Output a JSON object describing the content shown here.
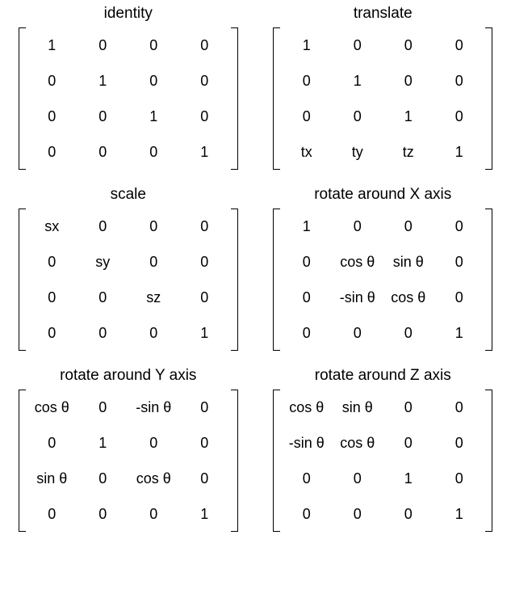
{
  "matrices": [
    {
      "id": "identity",
      "title": "identity",
      "rows": [
        [
          "1",
          "0",
          "0",
          "0"
        ],
        [
          "0",
          "1",
          "0",
          "0"
        ],
        [
          "0",
          "0",
          "1",
          "0"
        ],
        [
          "0",
          "0",
          "0",
          "1"
        ]
      ]
    },
    {
      "id": "translate",
      "title": "translate",
      "rows": [
        [
          "1",
          "0",
          "0",
          "0"
        ],
        [
          "0",
          "1",
          "0",
          "0"
        ],
        [
          "0",
          "0",
          "1",
          "0"
        ],
        [
          "tx",
          "ty",
          "tz",
          "1"
        ]
      ]
    },
    {
      "id": "scale",
      "title": "scale",
      "rows": [
        [
          "sx",
          "0",
          "0",
          "0"
        ],
        [
          "0",
          "sy",
          "0",
          "0"
        ],
        [
          "0",
          "0",
          "sz",
          "0"
        ],
        [
          "0",
          "0",
          "0",
          "1"
        ]
      ]
    },
    {
      "id": "rotate-x",
      "title": "rotate around X axis",
      "rows": [
        [
          "1",
          "0",
          "0",
          "0"
        ],
        [
          "0",
          "cos θ",
          "sin θ",
          "0"
        ],
        [
          "0",
          "-sin θ",
          "cos θ",
          "0"
        ],
        [
          "0",
          "0",
          "0",
          "1"
        ]
      ]
    },
    {
      "id": "rotate-y",
      "title": "rotate around Y axis",
      "rows": [
        [
          "cos θ",
          "0",
          "-sin θ",
          "0"
        ],
        [
          "0",
          "1",
          "0",
          "0"
        ],
        [
          "sin θ",
          "0",
          "cos θ",
          "0"
        ],
        [
          "0",
          "0",
          "0",
          "1"
        ]
      ]
    },
    {
      "id": "rotate-z",
      "title": "rotate around Z axis",
      "rows": [
        [
          "cos θ",
          "sin θ",
          "0",
          "0"
        ],
        [
          "-sin θ",
          "cos θ",
          "0",
          "0"
        ],
        [
          "0",
          "0",
          "1",
          "0"
        ],
        [
          "0",
          "0",
          "0",
          "1"
        ]
      ]
    }
  ],
  "chart_data": {
    "type": "table",
    "title": "4x4 transformation matrices",
    "tables": [
      {
        "name": "identity",
        "rows": [
          [
            "1",
            "0",
            "0",
            "0"
          ],
          [
            "0",
            "1",
            "0",
            "0"
          ],
          [
            "0",
            "0",
            "1",
            "0"
          ],
          [
            "0",
            "0",
            "0",
            "1"
          ]
        ]
      },
      {
        "name": "translate",
        "rows": [
          [
            "1",
            "0",
            "0",
            "0"
          ],
          [
            "0",
            "1",
            "0",
            "0"
          ],
          [
            "0",
            "0",
            "1",
            "0"
          ],
          [
            "tx",
            "ty",
            "tz",
            "1"
          ]
        ]
      },
      {
        "name": "scale",
        "rows": [
          [
            "sx",
            "0",
            "0",
            "0"
          ],
          [
            "0",
            "sy",
            "0",
            "0"
          ],
          [
            "0",
            "0",
            "sz",
            "0"
          ],
          [
            "0",
            "0",
            "0",
            "1"
          ]
        ]
      },
      {
        "name": "rotate around X axis",
        "rows": [
          [
            "1",
            "0",
            "0",
            "0"
          ],
          [
            "0",
            "cos θ",
            "sin θ",
            "0"
          ],
          [
            "0",
            "-sin θ",
            "cos θ",
            "0"
          ],
          [
            "0",
            "0",
            "0",
            "1"
          ]
        ]
      },
      {
        "name": "rotate around Y axis",
        "rows": [
          [
            "cos θ",
            "0",
            "-sin θ",
            "0"
          ],
          [
            "0",
            "1",
            "0",
            "0"
          ],
          [
            "sin θ",
            "0",
            "cos θ",
            "0"
          ],
          [
            "0",
            "0",
            "0",
            "1"
          ]
        ]
      },
      {
        "name": "rotate around Z axis",
        "rows": [
          [
            "cos θ",
            "sin θ",
            "0",
            "0"
          ],
          [
            "-sin θ",
            "cos θ",
            "0",
            "0"
          ],
          [
            "0",
            "0",
            "1",
            "0"
          ],
          [
            "0",
            "0",
            "0",
            "1"
          ]
        ]
      }
    ]
  }
}
